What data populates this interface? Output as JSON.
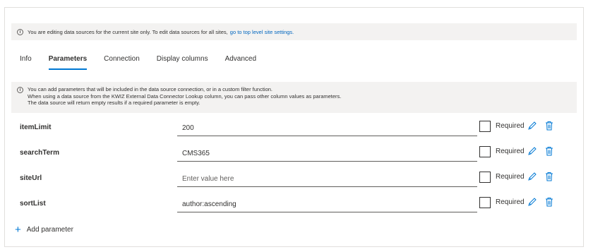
{
  "top_notice": {
    "text": "You are editing data sources for the current site only. To edit data sources for all sites,",
    "link": "go to top level site settings."
  },
  "tabs": [
    {
      "label": "Info",
      "active": false
    },
    {
      "label": "Parameters",
      "active": true
    },
    {
      "label": "Connection",
      "active": false
    },
    {
      "label": "Display columns",
      "active": false
    },
    {
      "label": "Advanced",
      "active": false
    }
  ],
  "params_notice": {
    "line1": "You can add parameters that will be included in the data source connection, or in a custom filter function.",
    "line2": "When using a data source from the KWIZ External Data Connector Lookup column, you can pass other column values as parameters.",
    "line3": "The data source will return empty results if a required parameter is empty."
  },
  "parameters": [
    {
      "name": "itemLimit",
      "value": "200",
      "placeholder": "",
      "required_label": "Required",
      "required": false
    },
    {
      "name": "searchTerm",
      "value": "CMS365",
      "placeholder": "",
      "required_label": "Required",
      "required": false
    },
    {
      "name": "siteUrl",
      "value": "",
      "placeholder": "Enter value here",
      "required_label": "Required",
      "required": false
    },
    {
      "name": "sortList",
      "value": "author:ascending",
      "placeholder": "",
      "required_label": "Required",
      "required": false
    }
  ],
  "add_parameter_label": "Add parameter",
  "icons": {
    "info": "info-icon",
    "edit": "pencil-icon",
    "delete": "trash-icon",
    "add": "plus-icon"
  },
  "colors": {
    "accent": "#0078d4",
    "link": "#0066bf",
    "notice_bg": "#f3f2f1",
    "text": "#323130"
  }
}
